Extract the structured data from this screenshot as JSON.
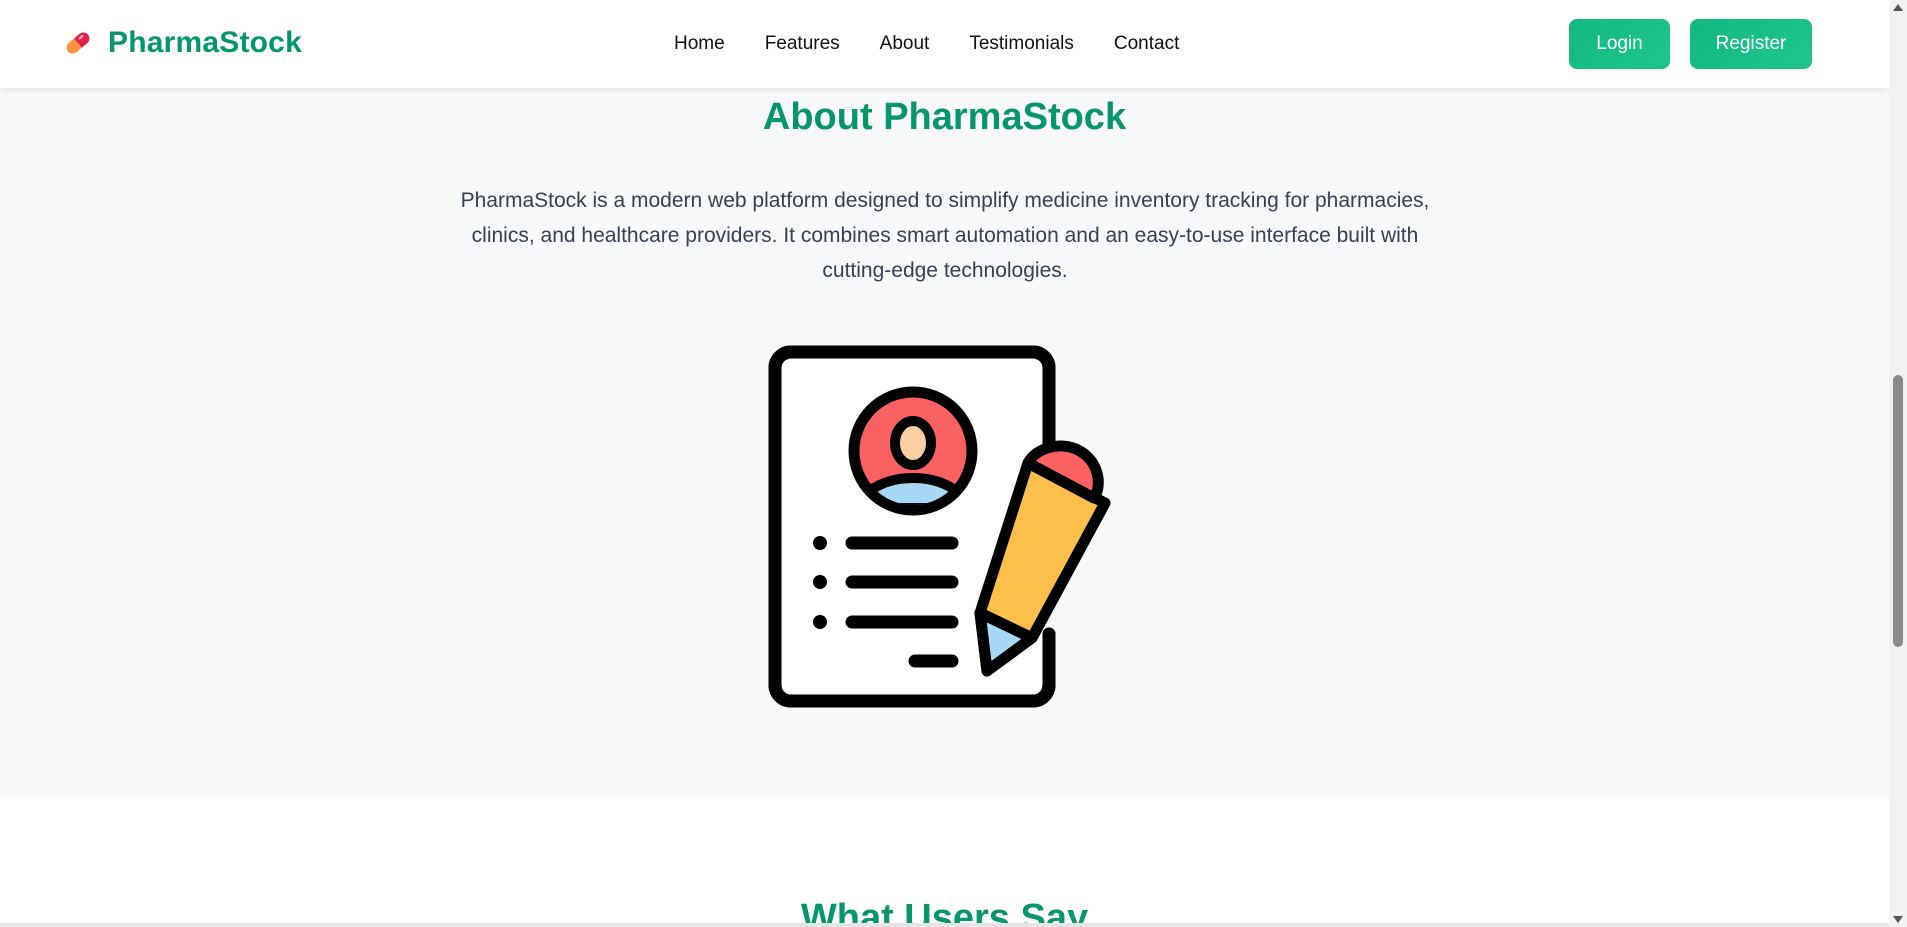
{
  "brand": {
    "name": "PharmaStock",
    "icon": "pill-icon"
  },
  "nav": {
    "links": [
      {
        "label": "Home"
      },
      {
        "label": "Features"
      },
      {
        "label": "About"
      },
      {
        "label": "Testimonials"
      },
      {
        "label": "Contact"
      }
    ],
    "login_label": "Login",
    "register_label": "Register"
  },
  "about": {
    "title": "About PharmaStock",
    "description": "PharmaStock is a modern web platform designed to simplify medicine inventory tracking for pharmacies, clinics, and healthcare providers. It combines smart automation and an easy-to-use interface built with cutting-edge technologies.",
    "illustration": "profile-document-pencil-icon"
  },
  "testimonials": {
    "title": "What Users Say"
  },
  "colors": {
    "brand": "#059669",
    "button": "#10b981",
    "section_bg": "#f8f9fb",
    "pencil_body": "#fbbf4a",
    "pencil_tip": "#fb6161",
    "avatar_bg": "#fb6161",
    "avatar_body": "#a7d8f5",
    "avatar_face": "#fccfa3"
  }
}
